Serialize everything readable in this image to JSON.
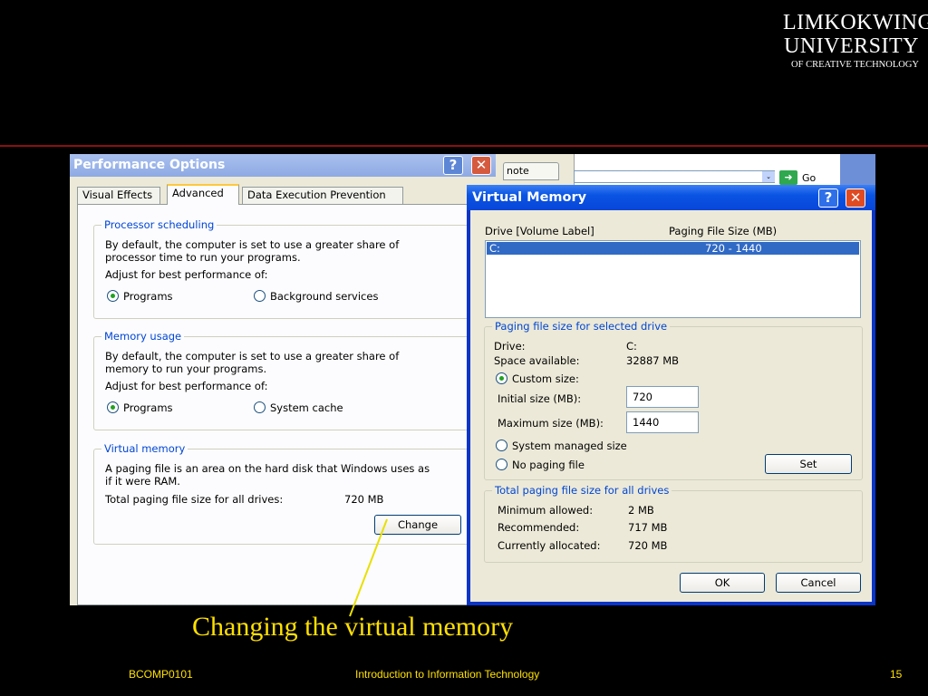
{
  "logo": {
    "line1": "LIMKOKWING",
    "line2": "UNIVERSITY",
    "line3": "OF CREATIVE TECHNOLOGY"
  },
  "performance": {
    "title": "Performance Options",
    "help": "?",
    "close": "✕",
    "tabs": [
      "Visual Effects",
      "Advanced",
      "Data Execution Prevention"
    ],
    "active_tab": "Advanced",
    "processor": {
      "title": "Processor scheduling",
      "desc1": "By default, the computer is set to use a greater share of",
      "desc2": "processor time to run your programs.",
      "adjust": "Adjust for best performance of:",
      "opt1": "Programs",
      "opt2": "Background services",
      "selected": "Programs"
    },
    "memory": {
      "title": "Memory usage",
      "desc1": "By default, the computer is set to use a greater share of",
      "desc2": "memory to run your programs.",
      "adjust": "Adjust for best performance of:",
      "opt1": "Programs",
      "opt2": "System cache",
      "selected": "Programs"
    },
    "virtual": {
      "title": "Virtual memory",
      "desc1": "A paging file is an area on the hard disk that Windows uses as",
      "desc2": "if it were RAM.",
      "total_label": "Total paging file size for all drives:",
      "total_value": "720 MB",
      "change": "Change"
    }
  },
  "background_window": {
    "tab": "note",
    "go": "Go",
    "dropdown": "⌄",
    "go_arrow": "➜"
  },
  "virtual_memory": {
    "title": "Virtual Memory",
    "help": "?",
    "close": "✕",
    "col_drive": "Drive  [Volume Label]",
    "col_size": "Paging File Size (MB)",
    "row_drive": "C:",
    "row_size": "720 - 1440",
    "selected": {
      "title": "Paging file size for selected drive",
      "drive_label": "Drive:",
      "drive_value": "C:",
      "space_label": "Space available:",
      "space_value": "32887 MB",
      "custom": "Custom size:",
      "initial_label": "Initial size (MB):",
      "initial_value": "720",
      "max_label": "Maximum size (MB):",
      "max_value": "1440",
      "system_managed": "System managed size",
      "no_paging": "No paging file",
      "set": "Set",
      "chosen": "Custom size"
    },
    "totals": {
      "title": "Total paging file size for all drives",
      "min_label": "Minimum allowed:",
      "min_value": "2 MB",
      "rec_label": "Recommended:",
      "rec_value": "717 MB",
      "cur_label": "Currently allocated:",
      "cur_value": "720 MB"
    },
    "ok": "OK",
    "cancel": "Cancel"
  },
  "caption": "Changing the virtual memory",
  "footer": {
    "course": "BCOMP0101",
    "title": "Introduction to Information Technology",
    "page": "15"
  },
  "colors": {
    "caption": "#ffe000",
    "xp_title": "#0a54e3",
    "group_title": "#0046d5",
    "selection": "#316ac5"
  }
}
